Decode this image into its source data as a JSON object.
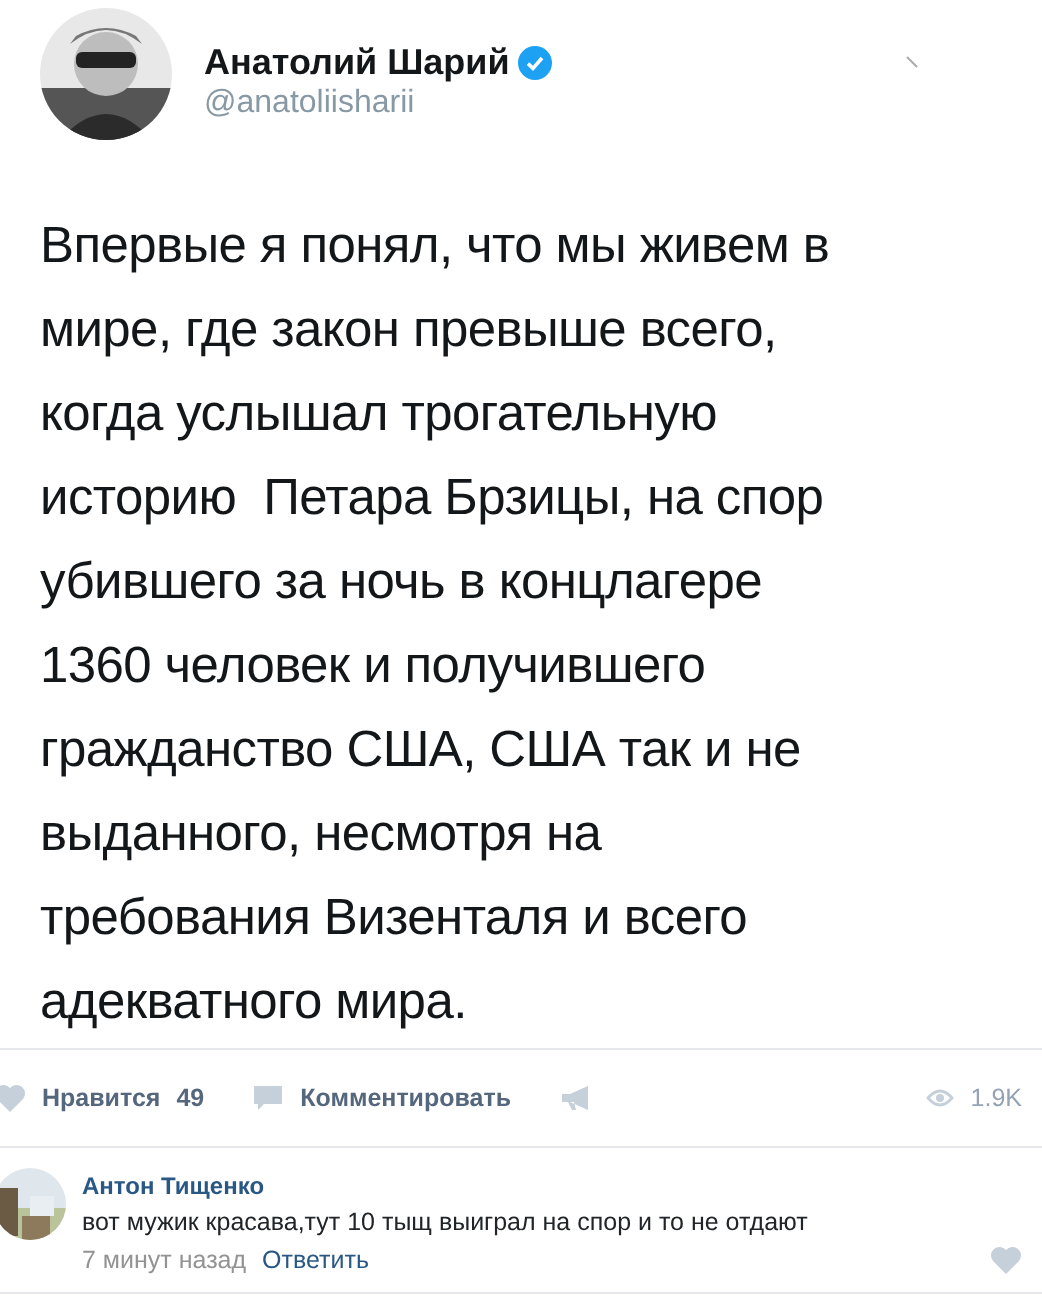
{
  "tweet": {
    "author": "Анатолий Шарий",
    "verified": true,
    "handle": "@anatoliisharii",
    "text": "Впервые я понял, что мы живем в\nмире, где закон превыше всего,\nкогда услышал трогательную\nисторию  Петара Брзицы, на спор\nубившего за ночь в концлагере\n1360 человек и получившего\nгражданство США, США так и не\nвыданного, несмотря на\nтребования Визенталя и всего\nадекватного мира."
  },
  "actions": {
    "like_label": "Нравится",
    "like_count": "49",
    "liked": false,
    "comment_label": "Комментировать",
    "views": "1.9K"
  },
  "comments": [
    {
      "author": "Антон Тищенко",
      "text": "вот мужик красава,тут 10 тыщ выиграл на спор и то не отдают",
      "time": "7 минут назад",
      "reply": "Ответить",
      "liked": false
    }
  ]
}
